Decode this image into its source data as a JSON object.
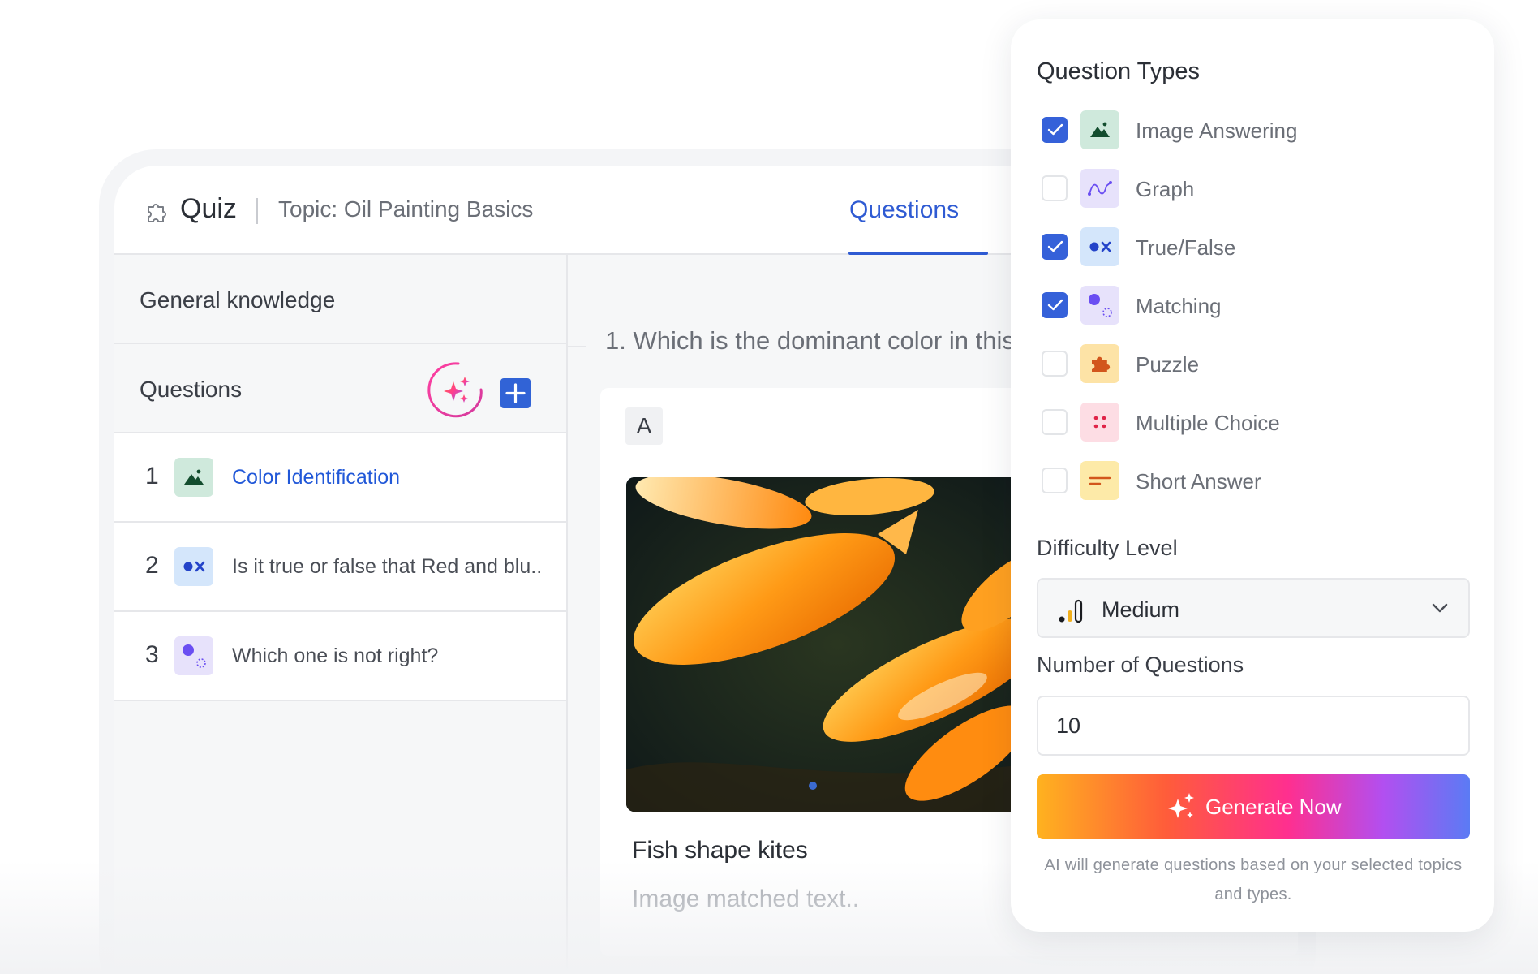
{
  "header": {
    "title": "Quiz",
    "topic": "Topic: Oil Painting Basics",
    "tab_questions": "Questions"
  },
  "sidebar": {
    "section": "General knowledge",
    "questions_label": "Questions",
    "items": [
      {
        "number": "1",
        "text": "Color Identification",
        "icon": "image-answering-icon"
      },
      {
        "number": "2",
        "text": "Is it true or false that Red and blu..",
        "icon": "true-false-icon"
      },
      {
        "number": "3",
        "text": "Which one is not right?",
        "icon": "matching-icon"
      }
    ]
  },
  "main": {
    "question": "1. Which is the dominant color in this",
    "answer": {
      "letter": "A",
      "title": "Fish shape kites",
      "subtitle": "Image matched text.."
    }
  },
  "panel": {
    "title": "Question Types",
    "types": [
      {
        "label": "Image Answering",
        "checked": true,
        "icon": "image-answering-icon"
      },
      {
        "label": "Graph",
        "checked": false,
        "icon": "graph-icon"
      },
      {
        "label": "True/False",
        "checked": true,
        "icon": "true-false-icon"
      },
      {
        "label": "Matching",
        "checked": true,
        "icon": "matching-icon"
      },
      {
        "label": "Puzzle",
        "checked": false,
        "icon": "puzzle-icon"
      },
      {
        "label": "Multiple Choice",
        "checked": false,
        "icon": "multiple-choice-icon"
      },
      {
        "label": "Short Answer",
        "checked": false,
        "icon": "short-answer-icon"
      }
    ],
    "difficulty_label": "Difficulty Level",
    "difficulty_value": "Medium",
    "count_label": "Number of Questions",
    "count_value": "10",
    "generate_label": "Generate Now",
    "hint": "AI will generate questions based on your selected topics and types."
  },
  "colors": {
    "accent": "#2f5bd3",
    "checkbox": "#3561d9",
    "gradient_start": "#ffb21f",
    "gradient_mid": "#ff2f8f",
    "gradient_end": "#5b7bf4"
  }
}
